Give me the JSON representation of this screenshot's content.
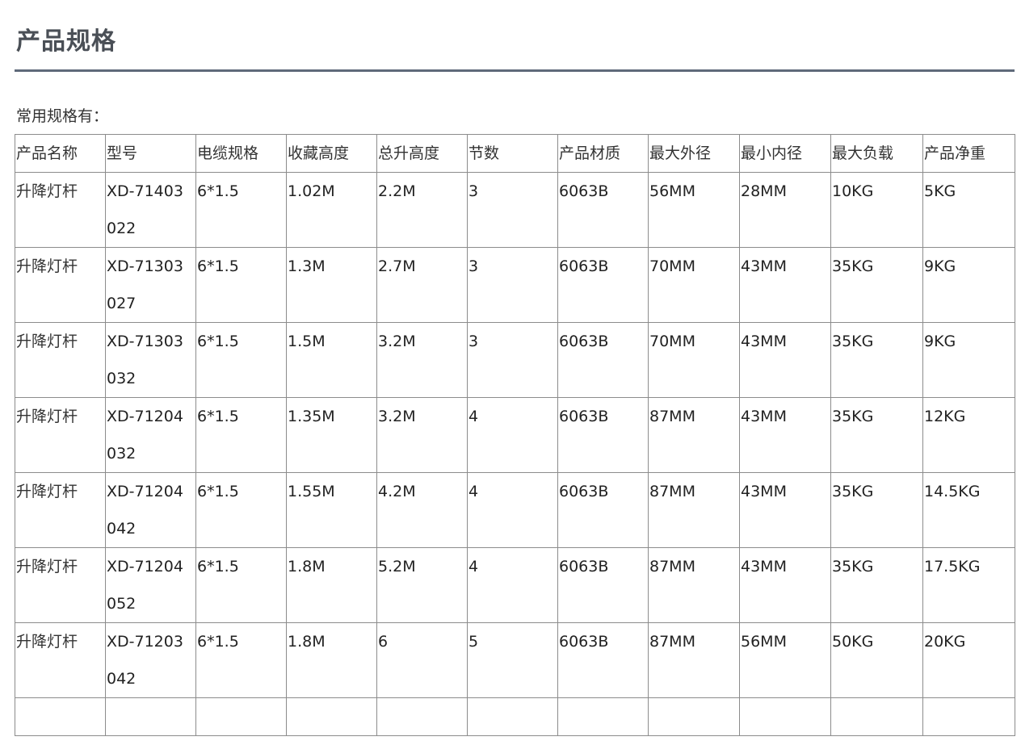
{
  "page": {
    "title": "产品规格",
    "intro": "常用规格有："
  },
  "table": {
    "headers": [
      "产品名称",
      "型号",
      "电缆规格",
      "收藏高度",
      "总升高度",
      "节数",
      "产品材质",
      "最大外径",
      "最小内径",
      "最大负载",
      "产品净重"
    ],
    "rows": [
      {
        "name": "升降灯杆",
        "model_l1": "XD-71403",
        "model_l2": "022",
        "cable": "6*1.5",
        "stowed": "1.02M",
        "total": "2.2M",
        "sections": "3",
        "material": "6063B",
        "max_od": "56MM",
        "min_id": "28MM",
        "max_load": "10KG",
        "net_weight": "5KG"
      },
      {
        "name": "升降灯杆",
        "model_l1": "XD-71303",
        "model_l2": "027",
        "cable": "6*1.5",
        "stowed": "1.3M",
        "total": "2.7M",
        "sections": "3",
        "material": "6063B",
        "max_od": "70MM",
        "min_id": "43MM",
        "max_load": "35KG",
        "net_weight": "9KG"
      },
      {
        "name": "升降灯杆",
        "model_l1": "XD-71303",
        "model_l2": "032",
        "cable": "6*1.5",
        "stowed": "1.5M",
        "total": "3.2M",
        "sections": "3",
        "material": "6063B",
        "max_od": "70MM",
        "min_id": "43MM",
        "max_load": "35KG",
        "net_weight": "9KG"
      },
      {
        "name": "升降灯杆",
        "model_l1": "XD-71204",
        "model_l2": "032",
        "cable": "6*1.5",
        "stowed": "1.35M",
        "total": "3.2M",
        "sections": "4",
        "material": "6063B",
        "max_od": "87MM",
        "min_id": "43MM",
        "max_load": "35KG",
        "net_weight": "12KG"
      },
      {
        "name": "升降灯杆",
        "model_l1": "XD-71204",
        "model_l2": "042",
        "cable": "6*1.5",
        "stowed": "1.55M",
        "total": "4.2M",
        "sections": "4",
        "material": "6063B",
        "max_od": "87MM",
        "min_id": "43MM",
        "max_load": "35KG",
        "net_weight": "14.5KG"
      },
      {
        "name": "升降灯杆",
        "model_l1": "XD-71204",
        "model_l2": "052",
        "cable": "6*1.5",
        "stowed": "1.8M",
        "total": "5.2M",
        "sections": "4",
        "material": "6063B",
        "max_od": "87MM",
        "min_id": "43MM",
        "max_load": "35KG",
        "net_weight": "17.5KG"
      },
      {
        "name": "升降灯杆",
        "model_l1": "XD-71203",
        "model_l2": "042",
        "cable": "6*1.5",
        "stowed": "1.8M",
        "total": "6",
        "sections": "5",
        "material": "6063B",
        "max_od": "87MM",
        "min_id": "56MM",
        "max_load": "50KG",
        "net_weight": "20KG"
      }
    ]
  },
  "colors": {
    "title_text": "#4a4f56",
    "title_rule": "#5f6a7a",
    "table_border": "#8c8c8c"
  }
}
